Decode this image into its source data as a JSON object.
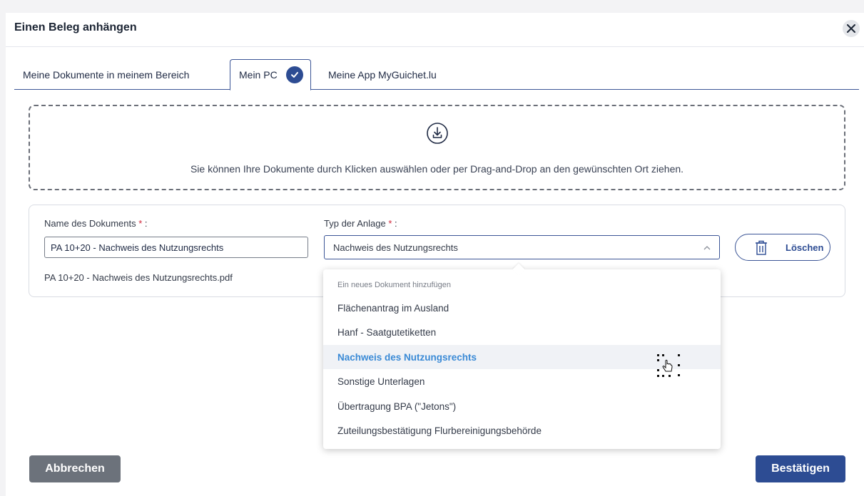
{
  "dialog": {
    "title": "Einen Beleg anhängen",
    "close_icon": "close-icon"
  },
  "tabs": [
    {
      "label": "Meine Dokumente in meinem Bereich",
      "active": false
    },
    {
      "label": "Mein PC",
      "active": true,
      "icon": "check-circle-icon"
    },
    {
      "label": "Meine App MyGuichet.lu",
      "active": false
    }
  ],
  "dropzone": {
    "icon": "download-icon",
    "text": "Sie können Ihre Dokumente durch Klicken auswählen oder per Drag-and-Drop an den gewünschten Ort ziehen."
  },
  "document": {
    "name_label": "Name des Dokuments",
    "type_label": "Typ der Anlage",
    "required_marker": "*",
    "label_suffix": " :",
    "name_value": "PA 10+20 - Nachweis des Nutzungsrechts",
    "file_name": "PA 10+20 - Nachweis des Nutzungsrechts.pdf",
    "type_value": "Nachweis des Nutzungsrechts",
    "delete_label": "Löschen",
    "delete_icon": "trash-icon"
  },
  "dropdown": {
    "group_label": "Ein neues Dokument hinzufügen",
    "items": [
      "Flächenantrag im Ausland",
      "Hanf - Saatgutetiketten",
      "Nachweis des Nutzungsrechts",
      "Sonstige Unterlagen",
      "Übertragung BPA (\"Jetons\")",
      "Zuteilungsbestätigung Flurbereinigungsbehörde"
    ],
    "selected_index": 2
  },
  "footer": {
    "cancel_label": "Abbrechen",
    "confirm_label": "Bestätigen"
  },
  "colors": {
    "primary": "#2d4c93",
    "selected_text": "#3a8ad6",
    "required": "#d0263a",
    "cancel": "#6c727b"
  }
}
